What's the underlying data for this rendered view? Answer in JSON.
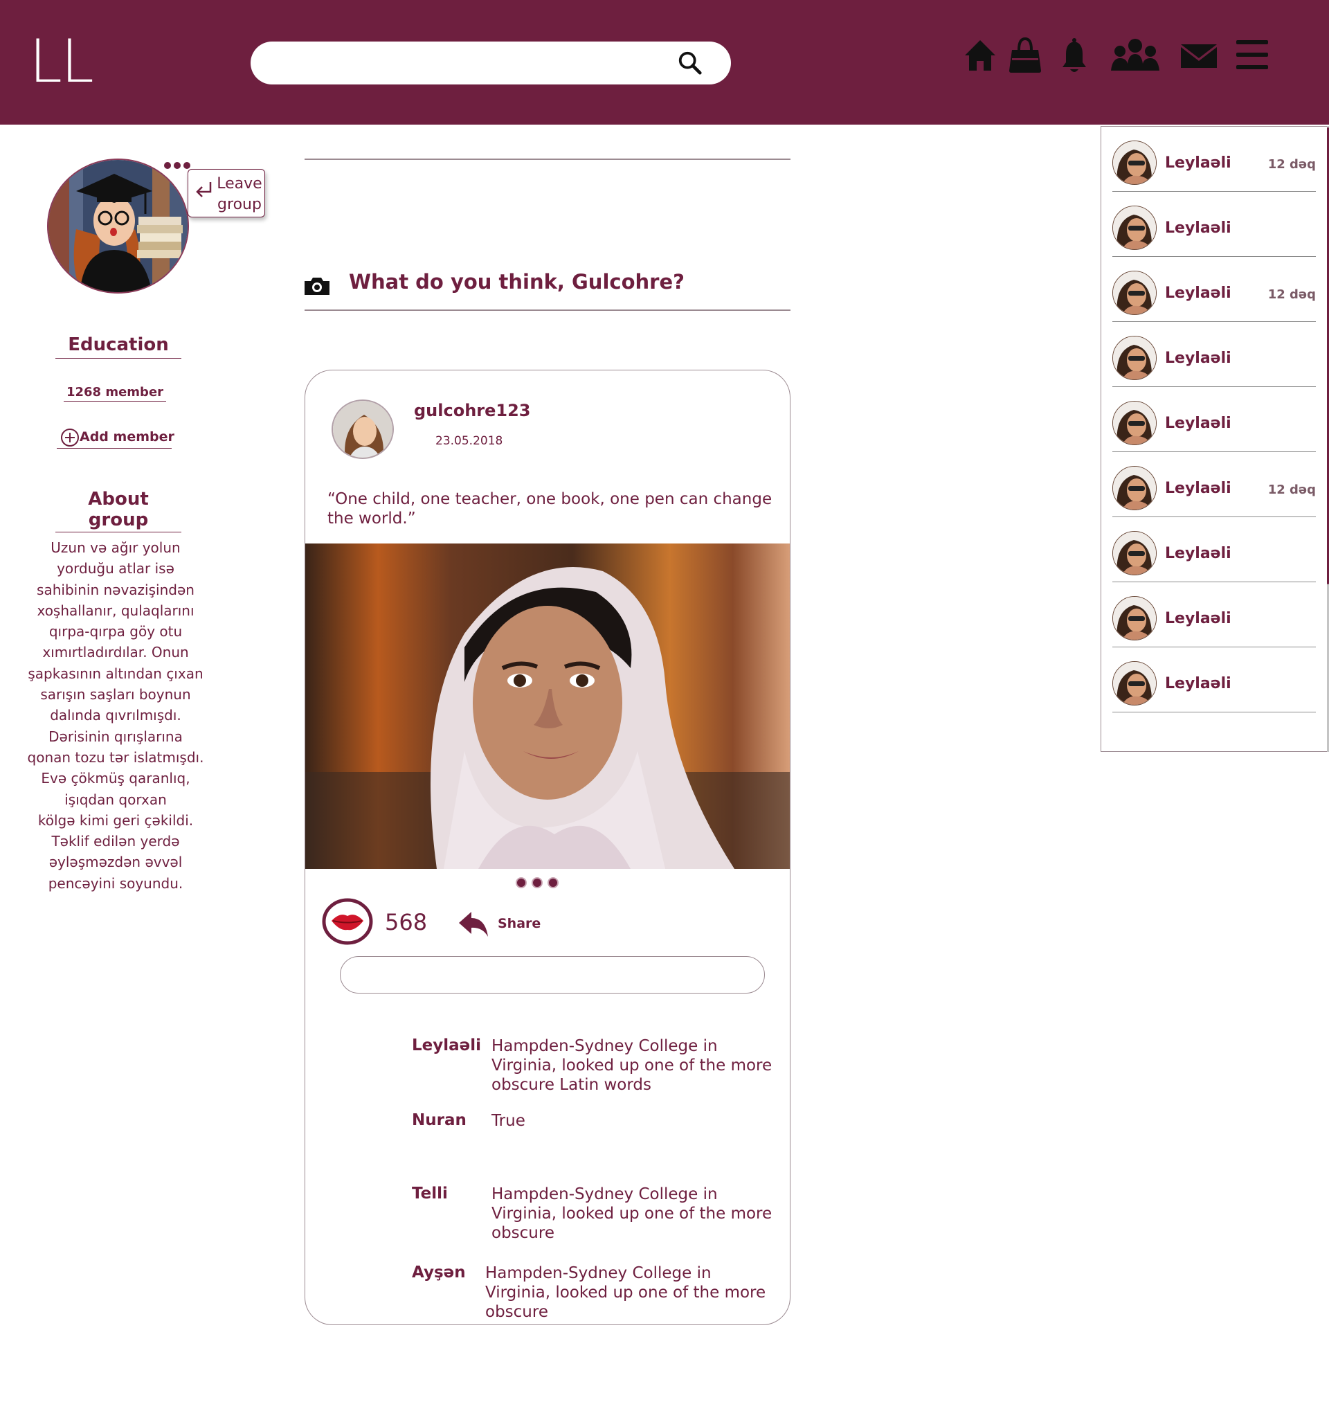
{
  "header": {
    "logo": "LL",
    "search": {
      "placeholder": "",
      "value": ""
    },
    "nav_icons": [
      "home-icon",
      "shopping-bag-icon",
      "bell-icon",
      "friends-icon",
      "mail-icon",
      "menu-icon"
    ]
  },
  "group": {
    "name": "Education",
    "member_count": "1268 member",
    "add_member_label": "Add member",
    "leave_label": "Leave group",
    "about_title": "About group",
    "about_lines": [
      "Uzun və ağır yolun",
      "yorduğu atlar isə",
      "sahibinin nəvazişindən",
      "xoşhallanır, qulaqlarını",
      "qırpa-qırpa göy otu",
      "xımırtladırdılar. Onun",
      "şapkasının altından çıxan",
      "sarışın saşları boynun",
      "dalında qıvrılmışdı.",
      "Dərisinin qırışlarına",
      "qonan tozu tər islatmışdı.",
      "Evə çökmüş qaranlıq,",
      "işıqdan qorxan",
      "kölgə kimi geri çəkildi.",
      "Təklif edilən yerdə",
      "əyləşməzdən əvvəl",
      "pencəyini soyundu."
    ]
  },
  "composer": {
    "prompt": "What do you think, Gulcohre?"
  },
  "post": {
    "username": "gulcohre123",
    "date": "23.05.2018",
    "quote": "“One child, one teacher, one book, one pen can change the world.”",
    "likes": "568",
    "share_label": "Share",
    "comment_placeholder": "",
    "comments": [
      {
        "author": "Leylaəli",
        "text": "Hampden-Sydney College in Virginia, looked up one of the more obscure Latin words"
      },
      {
        "author": "Nuran",
        "text": "True"
      },
      {
        "author": "Telli",
        "text": "Hampden-Sydney College in Virginia, looked up one of the more obscure"
      },
      {
        "author": "Ayşən",
        "text": "Hampden-Sydney College in Virginia, looked up one of the more obscure"
      }
    ]
  },
  "friends": [
    {
      "name": "Leylaəli",
      "time": "12 dəq"
    },
    {
      "name": "Leylaəli",
      "time": ""
    },
    {
      "name": "Leylaəli",
      "time": "12 dəq"
    },
    {
      "name": "Leylaəli",
      "time": ""
    },
    {
      "name": "Leylaəli",
      "time": ""
    },
    {
      "name": "Leylaəli",
      "time": "12 dəq"
    },
    {
      "name": "Leylaəli",
      "time": ""
    },
    {
      "name": "Leylaəli",
      "time": ""
    },
    {
      "name": "Leylaəli",
      "time": ""
    }
  ],
  "colors": {
    "brand": "#6e1f3f",
    "divider": "#9b8a91",
    "like_red": "#d0152a"
  }
}
